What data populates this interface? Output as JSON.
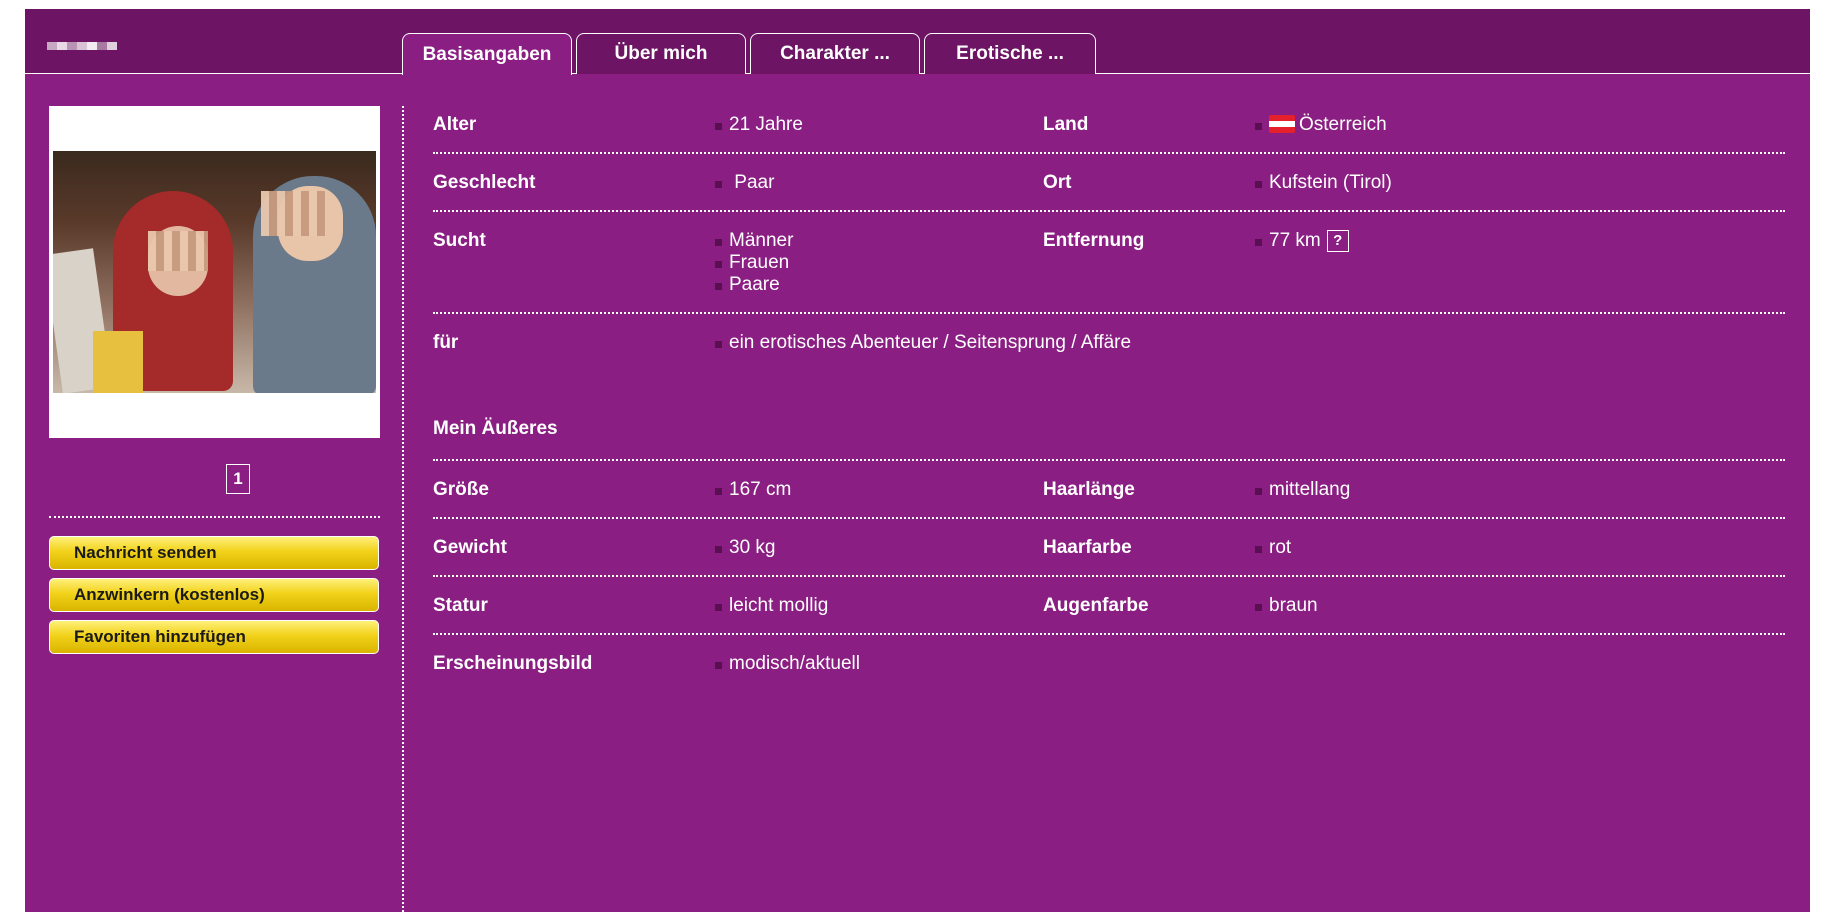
{
  "colors": {
    "page_bg": "#8a1e82",
    "topbar_bg": "#6d1464",
    "button_yellow": "#f2d21a",
    "bullet": "#5a0f52",
    "flag_red": "#e4202c"
  },
  "tabs": [
    {
      "label": "Basisangaben",
      "active": true
    },
    {
      "label": "Über mich",
      "active": false
    },
    {
      "label": "Charakter ...",
      "active": false
    },
    {
      "label": "Erotische ...",
      "active": false
    }
  ],
  "sidebar": {
    "photo_page": "1",
    "buttons": [
      "Nachricht senden",
      "Anzwinkern (kostenlos)",
      "Favoriten hinzufügen"
    ]
  },
  "basics": {
    "alter": {
      "label": "Alter",
      "value": "21 Jahre"
    },
    "land": {
      "label": "Land",
      "value": "Österreich",
      "flag": "austria-flag-icon"
    },
    "geschlecht": {
      "label": "Geschlecht",
      "value": " Paar"
    },
    "ort": {
      "label": "Ort",
      "value": "Kufstein (Tirol)"
    },
    "sucht": {
      "label": "Sucht",
      "values": [
        "Männer",
        "Frauen",
        "Paare"
      ]
    },
    "entfernung": {
      "label": "Entfernung",
      "value": "77 km",
      "help": "?"
    },
    "fuer": {
      "label": "für",
      "value": "ein erotisches Abenteuer / Seitensprung / Affäre"
    }
  },
  "appearance": {
    "title": "Mein Äußeres",
    "groesse": {
      "label": "Größe",
      "value": "167 cm"
    },
    "haarlaenge": {
      "label": "Haarlänge",
      "value": "mittellang"
    },
    "gewicht": {
      "label": "Gewicht",
      "value": "30 kg"
    },
    "haarfarbe": {
      "label": "Haarfarbe",
      "value": "rot"
    },
    "statur": {
      "label": "Statur",
      "value": "leicht mollig"
    },
    "augenfarbe": {
      "label": "Augenfarbe",
      "value": "braun"
    },
    "erscheinungsbild": {
      "label": "Erscheinungsbild",
      "value": "modisch/aktuell"
    }
  }
}
